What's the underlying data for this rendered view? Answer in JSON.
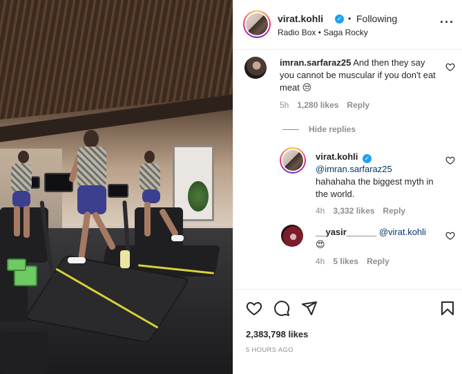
{
  "post": {
    "author": {
      "username": "virat.kohli",
      "verified": true,
      "follow_status": "Following",
      "separator": "•",
      "audio": "Radio Box • Saga Rocky"
    },
    "menu_icon": "more-horizontal-icon"
  },
  "comments": [
    {
      "username": "imran.sarfaraz25",
      "text": "And then they say you cannot be muscular if you don't eat meat 😒",
      "time": "5h",
      "likes": "1,280 likes",
      "reply_label": "Reply",
      "hide_replies_label": "Hide replies",
      "replies": [
        {
          "username": "virat.kohli",
          "verified": true,
          "mention": "@imran.sarfaraz25",
          "text": "hahahaha the biggest myth in the world.",
          "time": "4h",
          "likes": "3,332 likes",
          "reply_label": "Reply"
        },
        {
          "username": "__yasir______",
          "mention": "@virat.kohli",
          "text": "😍",
          "time": "4h",
          "likes": "5 likes",
          "reply_label": "Reply"
        }
      ]
    }
  ],
  "footer": {
    "icons": [
      "heart-icon",
      "comment-icon",
      "share-icon",
      "bookmark-icon"
    ],
    "likes_count": "2,383,798 likes",
    "time_ago": "5 HOURS AGO"
  },
  "colors": {
    "text": "#262626",
    "muted": "#8e8e8e",
    "mention": "#00376b",
    "verified": "#1da1f2",
    "border": "#efefef"
  }
}
